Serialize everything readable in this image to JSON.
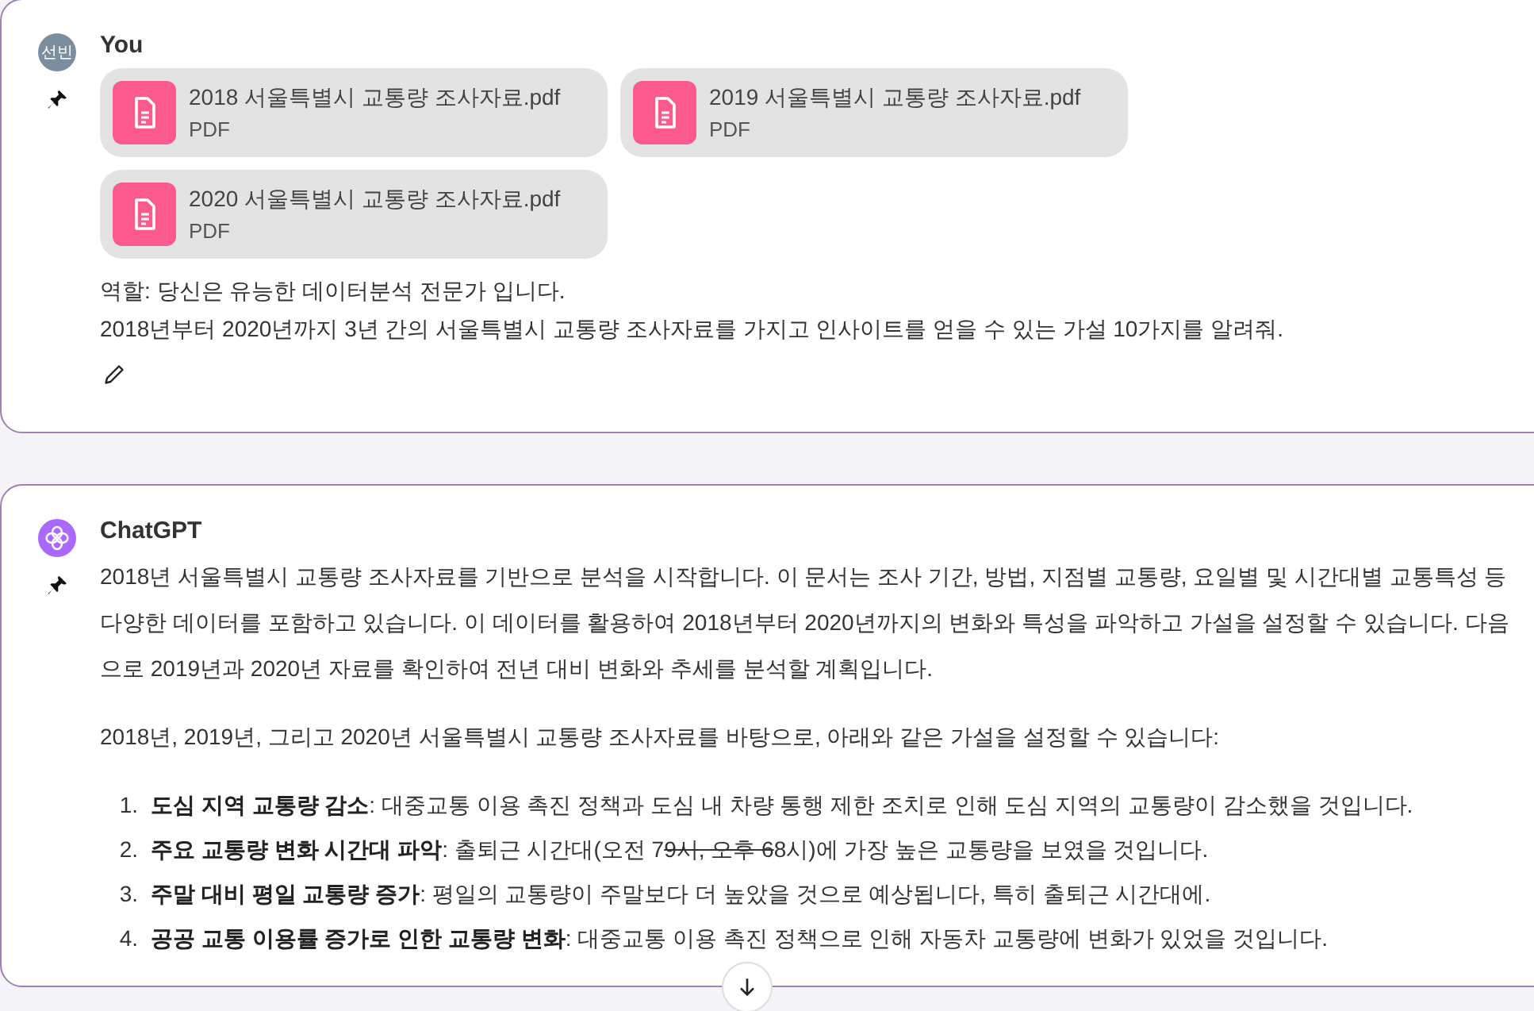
{
  "messages": [
    {
      "kind": "user",
      "avatar_text": "선빈",
      "author": "You",
      "pinned": true,
      "attachments": [
        {
          "name": "2018 서울특별시 교통량 조사자료.pdf",
          "type": "PDF"
        },
        {
          "name": "2019 서울특별시 교통량 조사자료.pdf",
          "type": "PDF"
        },
        {
          "name": "2020 서울특별시 교통량 조사자료.pdf",
          "type": "PDF"
        }
      ],
      "paragraphs": [
        "역할: 당신은 유능한 데이터분석 전문가 입니다.",
        "2018년부터 2020년까지 3년 간의 서울특별시 교통량 조사자료를 가지고 인사이트를 얻을 수 있는 가설 10가지를 알려줘."
      ],
      "editable": true
    },
    {
      "kind": "assistant",
      "author": "ChatGPT",
      "pinned": true,
      "paragraphs": [
        "2018년 서울특별시 교통량 조사자료를 기반으로 분석을 시작합니다. 이 문서는 조사 기간, 방법, 지점별 교통량, 요일별 및 시간대별 교통특성 등 다양한 데이터를 포함하고 있습니다. 이 데이터를 활용하여 2018년부터 2020년까지의 변화와 특성을 파악하고 가설을 설정할 수 있습니다. 다음으로 2019년과 2020년 자료를 확인하여 전년 대비 변화와 추세를 분석할 계획입니다.",
        "2018년, 2019년, 그리고 2020년 서울특별시 교통량 조사자료를 바탕으로, 아래와 같은 가설을 설정할 수 있습니다:"
      ],
      "list": [
        {
          "number": "1.",
          "parts": [
            {
              "text": "**도심 지역 교통량 감소**: 대중교통 이용 촉진 정책과 도심 내 차량 통행 제한 조치로 인해 도심 지역의 교통량이 감소했을 것입니다.",
              "struck": false
            }
          ]
        },
        {
          "number": "2.",
          "parts": [
            {
              "text": "**주요 교통량 변화 시간대 파악**: 출퇴근 시간대(오전 7",
              "struck": false
            },
            {
              "text": "9시, 오후 6",
              "struck": true
            },
            {
              "text": "8시)에 가장 높은 교통량을 보였을 것입니다.",
              "struck": false
            }
          ]
        },
        {
          "number": "3.",
          "parts": [
            {
              "text": "**주말 대비 평일 교통량 증가**: 평일의 교통량이 주말보다 더 높았을 것으로 예상됩니다, 특히 출퇴근 시간대에.",
              "struck": false
            }
          ]
        },
        {
          "number": "4.",
          "parts": [
            {
              "text": "**공공 교통 이용률 증가로 인한 교통량 변화**: 대중교통 이용 촉진 정책으로 인해 자동차 교통량에 변화가 있었을 것입니다.",
              "struck": false
            }
          ]
        }
      ]
    }
  ],
  "scroll_down_button": true
}
